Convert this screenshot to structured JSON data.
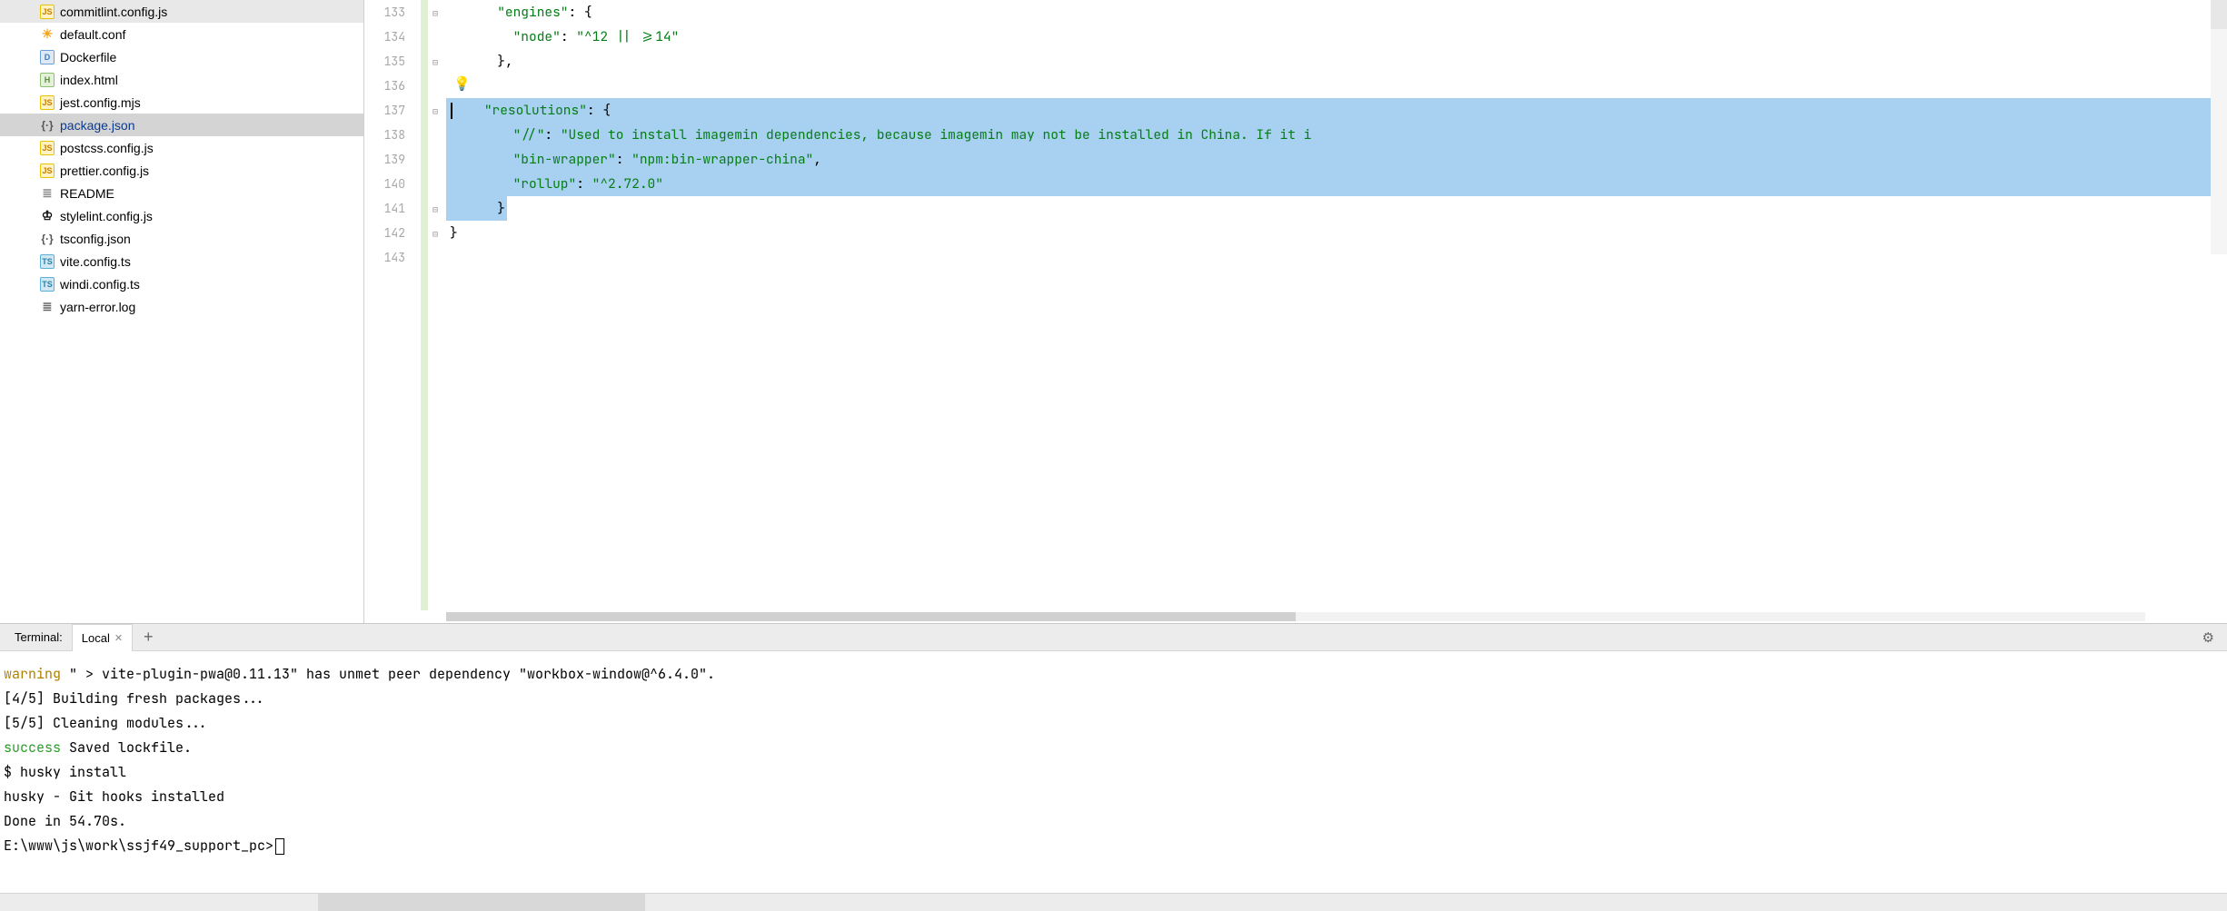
{
  "sidebar": {
    "files": [
      {
        "name": "commitlint.config.js",
        "iconClass": "icon-js",
        "iconText": "JS",
        "selected": false
      },
      {
        "name": "default.conf",
        "iconClass": "icon-conf",
        "iconText": "☀",
        "selected": false
      },
      {
        "name": "Dockerfile",
        "iconClass": "icon-docker",
        "iconText": "D",
        "selected": false
      },
      {
        "name": "index.html",
        "iconClass": "icon-html",
        "iconText": "H",
        "selected": false
      },
      {
        "name": "jest.config.mjs",
        "iconClass": "icon-js",
        "iconText": "JS",
        "selected": false
      },
      {
        "name": "package.json",
        "iconClass": "icon-json",
        "iconText": "{·}",
        "selected": true
      },
      {
        "name": "postcss.config.js",
        "iconClass": "icon-js",
        "iconText": "JS",
        "selected": false
      },
      {
        "name": "prettier.config.js",
        "iconClass": "icon-js",
        "iconText": "JS",
        "selected": false
      },
      {
        "name": "README",
        "iconClass": "icon-file",
        "iconText": "≣",
        "selected": false
      },
      {
        "name": "stylelint.config.js",
        "iconClass": "icon-style",
        "iconText": "♔",
        "selected": false
      },
      {
        "name": "tsconfig.json",
        "iconClass": "icon-json",
        "iconText": "{·}",
        "selected": false
      },
      {
        "name": "vite.config.ts",
        "iconClass": "icon-ts",
        "iconText": "TS",
        "selected": false
      },
      {
        "name": "windi.config.ts",
        "iconClass": "icon-ts",
        "iconText": "TS",
        "selected": false
      },
      {
        "name": "yarn-error.log",
        "iconClass": "icon-log",
        "iconText": "≣",
        "selected": false
      }
    ]
  },
  "editor": {
    "lineStart": 133,
    "lines": [
      {
        "num": "133",
        "tokens": [
          {
            "t": "      ",
            "c": ""
          },
          {
            "t": "\"engines\"",
            "c": "tk-key"
          },
          {
            "t": ": {",
            "c": "tk-punc"
          }
        ],
        "sel": false
      },
      {
        "num": "134",
        "tokens": [
          {
            "t": "        ",
            "c": ""
          },
          {
            "t": "\"node\"",
            "c": "tk-key"
          },
          {
            "t": ": ",
            "c": "tk-punc"
          },
          {
            "t": "\"^12 || >=14\"",
            "c": "tk-str"
          }
        ],
        "sel": false
      },
      {
        "num": "135",
        "tokens": [
          {
            "t": "      },",
            "c": "tk-punc"
          }
        ],
        "sel": false
      },
      {
        "num": "136",
        "tokens": [
          {
            "t": " ",
            "c": ""
          }
        ],
        "sel": false
      },
      {
        "num": "137",
        "tokens": [
          {
            "t": "    ",
            "c": ""
          },
          {
            "t": "\"resolutions\"",
            "c": "tk-key"
          },
          {
            "t": ": {",
            "c": "tk-punc"
          }
        ],
        "sel": true,
        "hl": true,
        "cursor": true
      },
      {
        "num": "138",
        "tokens": [
          {
            "t": "        ",
            "c": ""
          },
          {
            "t": "\"//\"",
            "c": "tk-key"
          },
          {
            "t": ": ",
            "c": "tk-punc"
          },
          {
            "t": "\"Used to install imagemin dependencies, because imagemin may not be installed in China. If it i",
            "c": "tk-str"
          }
        ],
        "sel": true
      },
      {
        "num": "139",
        "tokens": [
          {
            "t": "        ",
            "c": ""
          },
          {
            "t": "\"bin-wrapper\"",
            "c": "tk-key"
          },
          {
            "t": ": ",
            "c": "tk-punc"
          },
          {
            "t": "\"npm:bin-wrapper-china\"",
            "c": "tk-str"
          },
          {
            "t": ",",
            "c": "tk-punc"
          }
        ],
        "sel": true
      },
      {
        "num": "140",
        "tokens": [
          {
            "t": "        ",
            "c": ""
          },
          {
            "t": "\"rollup\"",
            "c": "tk-key"
          },
          {
            "t": ": ",
            "c": "tk-punc"
          },
          {
            "t": "\"^2.72.0\"",
            "c": "tk-str"
          }
        ],
        "sel": true
      },
      {
        "num": "141",
        "tokens": [
          {
            "t": "      }",
            "c": "tk-punc"
          }
        ],
        "sel": false,
        "partialSelTo": 7
      },
      {
        "num": "142",
        "tokens": [
          {
            "t": "}",
            "c": "tk-punc"
          }
        ],
        "sel": false
      },
      {
        "num": "143",
        "tokens": [
          {
            "t": "",
            "c": ""
          }
        ],
        "sel": false
      }
    ]
  },
  "terminal": {
    "label": "Terminal:",
    "tab": "Local",
    "lines": [
      {
        "segs": [
          {
            "t": "warning",
            "c": "t-warn"
          },
          {
            "t": " \" > vite-plugin-pwa@0.11.13\" has unmet peer dependency \"workbox-window@^6.4.0\".",
            "c": "t-norm"
          }
        ]
      },
      {
        "segs": [
          {
            "t": "[4/5] Building fresh packages...",
            "c": "t-norm"
          }
        ]
      },
      {
        "segs": [
          {
            "t": "[5/5] Cleaning modules...",
            "c": "t-norm"
          }
        ]
      },
      {
        "segs": [
          {
            "t": "success",
            "c": "t-succ"
          },
          {
            "t": " Saved lockfile.",
            "c": "t-norm"
          }
        ]
      },
      {
        "segs": [
          {
            "t": "$ husky install",
            "c": "t-norm"
          }
        ]
      },
      {
        "segs": [
          {
            "t": "husky - Git hooks installed",
            "c": "t-norm"
          }
        ]
      },
      {
        "segs": [
          {
            "t": "Done in 54.70s.",
            "c": "t-norm"
          }
        ]
      },
      {
        "segs": [
          {
            "t": "",
            "c": ""
          }
        ]
      },
      {
        "segs": [
          {
            "t": "E:\\www\\js\\work\\ssjf49_support_pc>",
            "c": "t-norm"
          }
        ],
        "cursor": true
      }
    ]
  }
}
